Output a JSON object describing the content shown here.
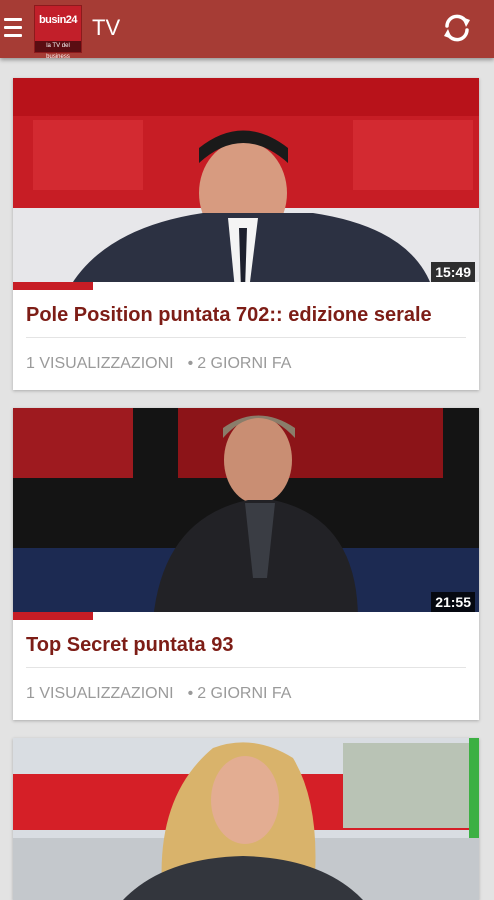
{
  "header": {
    "logo_text": "busin24",
    "logo_subtext": "la TV del business",
    "title": "TV",
    "menu_icon": "hamburger-menu-icon",
    "refresh_icon": "refresh-icon",
    "bar_color": "#a63c35"
  },
  "videos": [
    {
      "title": "Pole Position puntata 702:: edizione serale",
      "duration": "15:49",
      "views": "1 VISUALIZZAZIONI",
      "age": "2 GIORNI FA"
    },
    {
      "title": "Top Secret puntata 93",
      "duration": "21:55",
      "views": "1 VISUALIZZAZIONI",
      "age": "2 GIORNI FA"
    },
    {
      "title": "",
      "duration": "",
      "views": "",
      "age": ""
    }
  ],
  "colors": {
    "title_text": "#7d1d16",
    "meta_text": "#9a9a9a",
    "background": "#e3e3e3"
  }
}
